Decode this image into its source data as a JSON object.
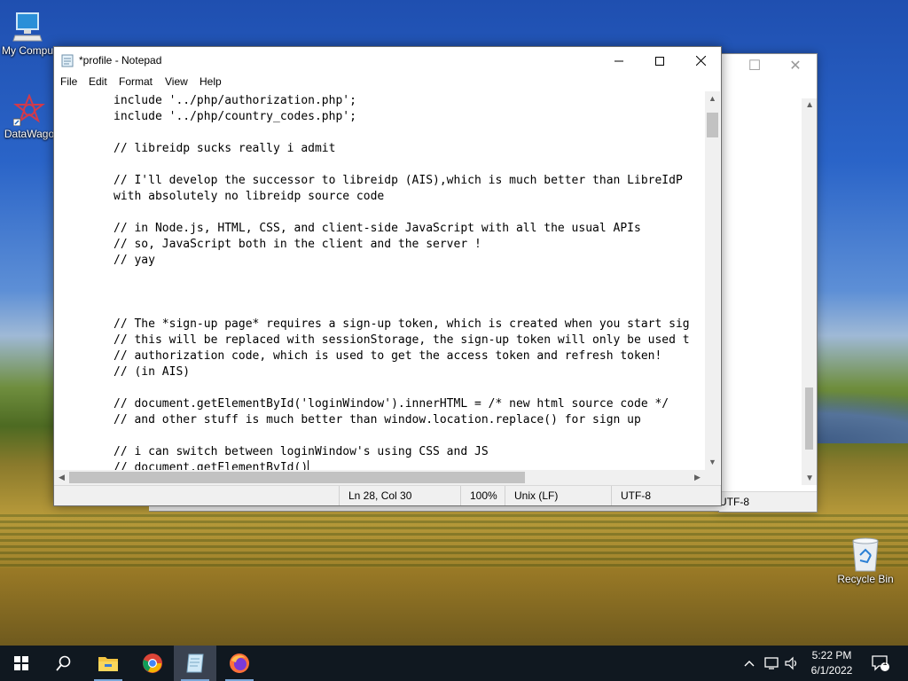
{
  "desktop": {
    "icons": [
      {
        "label": "My Compu"
      },
      {
        "label": "DataWago"
      }
    ],
    "recycle_bin": {
      "label": "Recycle Bin"
    }
  },
  "background_window": {
    "status_encoding": "UTF-8"
  },
  "notepad": {
    "title": "*profile - Notepad",
    "menu": [
      "File",
      "Edit",
      "Format",
      "View",
      "Help"
    ],
    "lines": [
      "include '../php/authorization.php';",
      "include '../php/country_codes.php';",
      "",
      "// libreidp sucks really i admit",
      "",
      "// I'll develop the successor to libreidp (AIS),which is much better than LibreIdP",
      "with absolutely no libreidp source code",
      "",
      "// in Node.js, HTML, CSS, and client-side JavaScript with all the usual APIs",
      "// so, JavaScript both in the client and the server !",
      "// yay",
      "",
      "",
      "",
      "// The *sign-up page* requires a sign-up token, which is created when you start sig",
      "// this will be replaced with sessionStorage, the sign-up token will only be used t",
      "// authorization code, which is used to get the access token and refresh token!",
      "// (in AIS)",
      "",
      "// document.getElementById('loginWindow').innerHTML = /* new html source code */",
      "// and other stuff is much better than window.location.replace() for sign up",
      "",
      "// i can switch between loginWindow's using CSS and JS",
      "// document.getElementById()"
    ],
    "status": {
      "position": "Ln 28, Col 30",
      "zoom": "100%",
      "line_ending": "Unix (LF)",
      "encoding": "UTF-8"
    }
  },
  "taskbar": {
    "apps": [
      "start-icon",
      "search-icon",
      "file-explorer-icon",
      "chrome-icon",
      "notepad-icon",
      "firefox-icon"
    ],
    "clock": {
      "time": "5:22 PM",
      "date": "6/1/2022"
    },
    "notification_count": "1"
  }
}
